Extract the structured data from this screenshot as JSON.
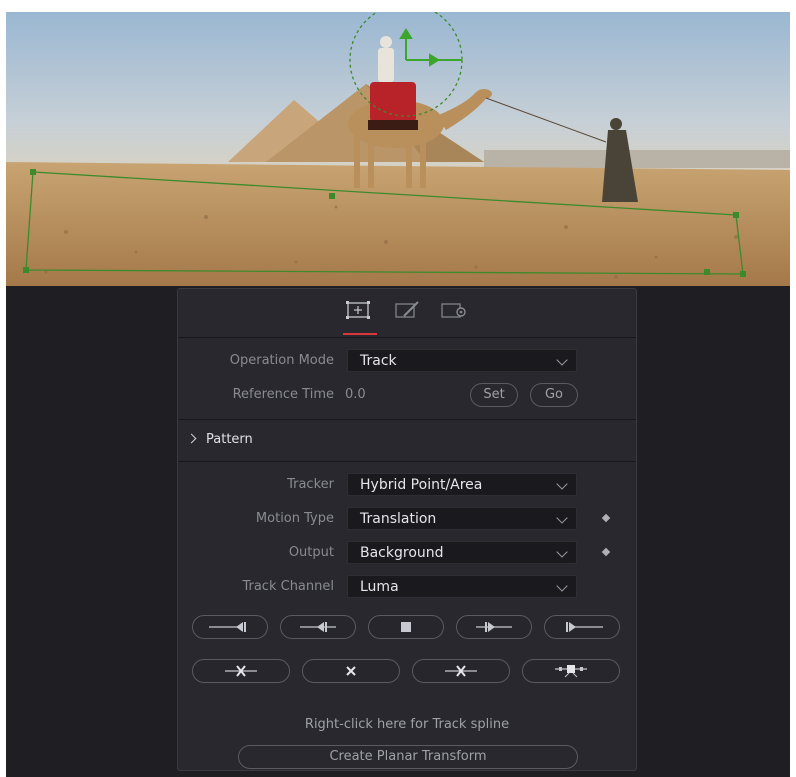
{
  "viewer": {
    "description_color_sky": "#a9c3d9",
    "overlay_color": "#3d8a2c"
  },
  "toolbar": {
    "tabs": [
      {
        "name": "tracker-controls-tab",
        "active": true
      },
      {
        "name": "operation-tab",
        "active": false
      },
      {
        "name": "options-tab",
        "active": false
      }
    ]
  },
  "fields": {
    "operation_mode_label": "Operation Mode",
    "operation_mode_value": "Track",
    "reference_time_label": "Reference Time",
    "reference_time_value": "0.0",
    "set_label": "Set",
    "go_label": "Go"
  },
  "pattern": {
    "label": "Pattern"
  },
  "tracker": {
    "tracker_label": "Tracker",
    "tracker_value": "Hybrid Point/Area",
    "motion_type_label": "Motion Type",
    "motion_type_value": "Translation",
    "output_label": "Output",
    "output_value": "Background",
    "track_channel_label": "Track Channel",
    "track_channel_value": "Luma"
  },
  "footer": {
    "hint": "Right-click here for Track spline",
    "create_planar_label": "Create Planar Transform"
  },
  "colors": {
    "accent_underline": "#d9373b",
    "panel_bg": "#28282e"
  }
}
